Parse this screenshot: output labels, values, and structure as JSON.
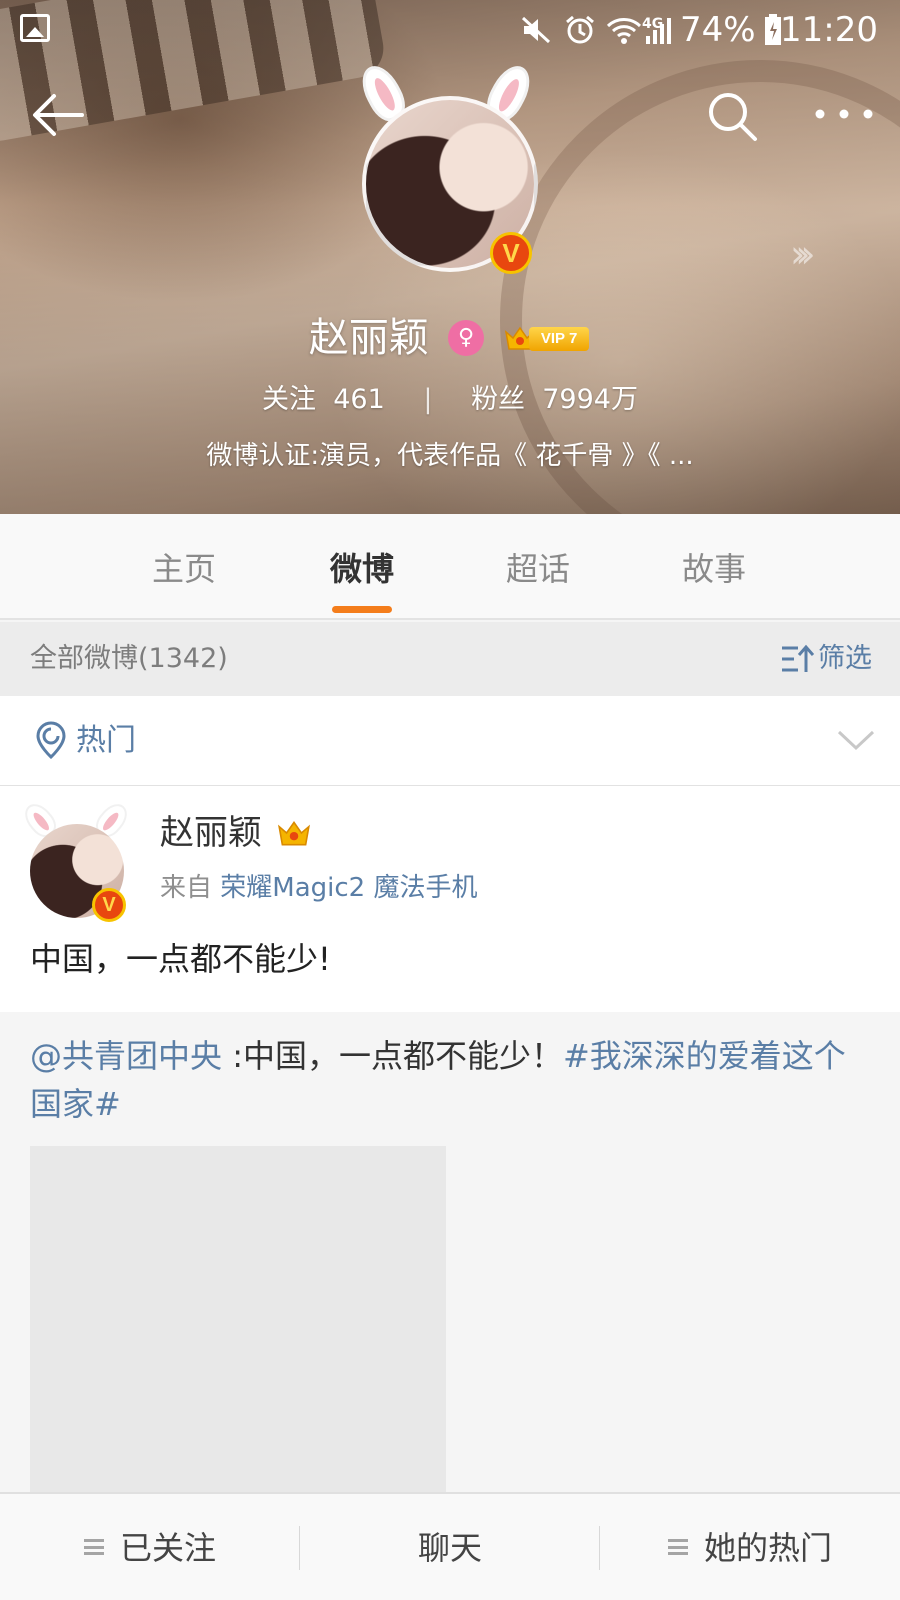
{
  "status_bar": {
    "battery": "74%",
    "time": "11:20",
    "network": "4G",
    "icons": [
      "gallery-icon",
      "mute-icon",
      "alarm-icon",
      "wifi-icon",
      "signal-icon",
      "battery-icon"
    ]
  },
  "nav": {
    "icons": [
      "back-arrow-icon",
      "search-icon",
      "more-icon"
    ]
  },
  "profile": {
    "name": "赵丽颖",
    "vip_text": "VIP 7",
    "following_label": "关注",
    "following_count": "461",
    "separator": "|",
    "followers_label": "粉丝",
    "followers_count": "7994万",
    "verification": "微博认证:演员，代表作品《 花千骨 》《 ..."
  },
  "tabs": [
    {
      "label": "主页",
      "active": false
    },
    {
      "label": "微博",
      "active": true
    },
    {
      "label": "超话",
      "active": false
    },
    {
      "label": "故事",
      "active": false
    }
  ],
  "filter_bar": {
    "all_label": "全部微博(1342)",
    "filter_label": "筛选"
  },
  "hot_row": {
    "label": "热门"
  },
  "post": {
    "author": "赵丽颖",
    "source_prefix": "来自",
    "source_device": "荣耀Magic2 魔法手机",
    "text": "中国，一点都不能少!"
  },
  "repost": {
    "mention": "@共青团中央",
    "text_mid": " :中国，一点都不能少！",
    "hashtag": "#我深深的爱着这个国家#"
  },
  "bottom_bar": {
    "followed": "已关注",
    "chat": "聊天",
    "her_hot": "她的热门"
  },
  "colors": {
    "accent_orange": "#f47d1b",
    "link_blue": "#5a7ea6",
    "vip_gold": "#f0a400",
    "verified_red": "#e8470f"
  }
}
